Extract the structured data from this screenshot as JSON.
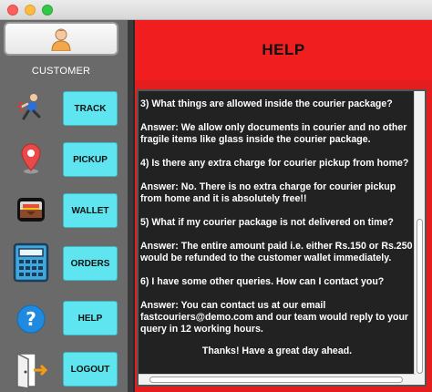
{
  "sidebar": {
    "user_label": "CUSTOMER",
    "items": [
      {
        "label": "TRACK",
        "icon": "runner-icon"
      },
      {
        "label": "PICKUP",
        "icon": "location-pin-icon"
      },
      {
        "label": "WALLET",
        "icon": "wallet-icon"
      },
      {
        "label": "ORDERS",
        "icon": "calculator-icon"
      },
      {
        "label": "HELP",
        "icon": "question-icon"
      },
      {
        "label": "LOGOUT",
        "icon": "exit-door-icon"
      }
    ]
  },
  "header": {
    "title": "HELP"
  },
  "faq": {
    "items": [
      {
        "question": "3) What things are allowed inside the courier package?",
        "answer": "Answer: We allow only documents in courier and no other fragile items like glass inside the courier package."
      },
      {
        "question": "4) Is there any extra charge for courier pickup from home?",
        "answer": "Answer: No. There is no extra charge for courier pickup from home and it is absolutely free!!"
      },
      {
        "question": "5) What if my courier package is not delivered on time?",
        "answer": "Answer: The entire amount paid i.e. either Rs.150 or Rs.250 would be refunded to the customer wallet immediately."
      },
      {
        "question": "6) I have some other queries. How can I contact you?",
        "answer": "Answer: You can contact us at our email fastcouriers@demo.com and our team would reply to your query in 12 working hours."
      }
    ],
    "closing": "Thanks! Have a great day ahead."
  },
  "colors": {
    "header_red": "#f01e1e",
    "button_cyan": "#5ee5ef",
    "sidebar_gray": "#6a6a6a",
    "content_dark": "#222222"
  }
}
